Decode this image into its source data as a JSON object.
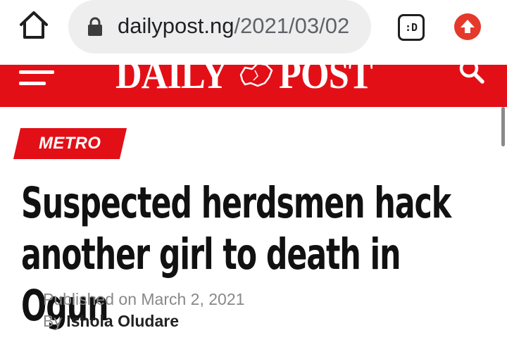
{
  "browser": {
    "url_domain": "dailypost.ng",
    "url_path": "/2021/03/02",
    "tabs_label": ":D",
    "icons": {
      "home": "home-icon",
      "lock": "lock-icon",
      "tabs": "tab-switcher-icon",
      "update": "update-arrow-icon"
    },
    "update_color": "#e5392b"
  },
  "site": {
    "logo_left": "DAILY",
    "logo_right": "POST",
    "header_color": "#e30f17",
    "icons": {
      "menu": "hamburger-menu-icon",
      "map": "nigeria-map-icon",
      "search": "search-icon"
    }
  },
  "article": {
    "category": "METRO",
    "title_line1": "Suspected herdsmen hack",
    "title_line2": "another girl to death in Ogun",
    "published_prefix": "Published on ",
    "published_date": "March 2, 2021",
    "by_prefix": "By ",
    "author": "Ishola Oludare"
  }
}
